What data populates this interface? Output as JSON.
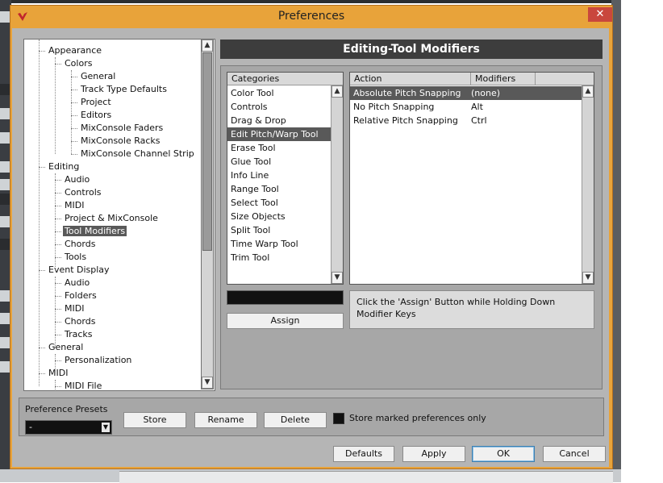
{
  "window": {
    "title": "Preferences",
    "close_glyph": "✕"
  },
  "tree": {
    "items": [
      {
        "label": "Appearance",
        "level": 1
      },
      {
        "label": "Colors",
        "level": 2
      },
      {
        "label": "General",
        "level": 3
      },
      {
        "label": "Track Type Defaults",
        "level": 3
      },
      {
        "label": "Project",
        "level": 3
      },
      {
        "label": "Editors",
        "level": 3
      },
      {
        "label": "MixConsole Faders",
        "level": 3
      },
      {
        "label": "MixConsole Racks",
        "level": 3
      },
      {
        "label": "MixConsole Channel Strip",
        "level": 3
      },
      {
        "label": "Editing",
        "level": 1
      },
      {
        "label": "Audio",
        "level": 2
      },
      {
        "label": "Controls",
        "level": 2
      },
      {
        "label": "MIDI",
        "level": 2
      },
      {
        "label": "Project & MixConsole",
        "level": 2
      },
      {
        "label": "Tool Modifiers",
        "level": 2,
        "selected": true
      },
      {
        "label": "Chords",
        "level": 2
      },
      {
        "label": "Tools",
        "level": 2
      },
      {
        "label": "Event Display",
        "level": 1
      },
      {
        "label": "Audio",
        "level": 2
      },
      {
        "label": "Folders",
        "level": 2
      },
      {
        "label": "MIDI",
        "level": 2
      },
      {
        "label": "Chords",
        "level": 2
      },
      {
        "label": "Tracks",
        "level": 2
      },
      {
        "label": "General",
        "level": 1
      },
      {
        "label": "Personalization",
        "level": 2
      },
      {
        "label": "MIDI",
        "level": 1
      },
      {
        "label": "MIDI File",
        "level": 2
      }
    ]
  },
  "panel": {
    "title": "Editing-Tool Modifiers",
    "categories": {
      "header": "Categories",
      "items": [
        "Color Tool",
        "Controls",
        "Drag & Drop",
        "Edit Pitch/Warp Tool",
        "Erase Tool",
        "Glue Tool",
        "Info Line",
        "Range Tool",
        "Select Tool",
        "Size Objects",
        "Split Tool",
        "Time Warp Tool",
        "Trim Tool"
      ],
      "selected_index": 3
    },
    "actions": {
      "headers": {
        "action": "Action",
        "modifiers": "Modifiers"
      },
      "rows": [
        {
          "action": "Absolute Pitch Snapping",
          "modifiers": "(none)"
        },
        {
          "action": "No Pitch Snapping",
          "modifiers": "Alt"
        },
        {
          "action": "Relative Pitch Snapping",
          "modifiers": "Ctrl"
        }
      ],
      "selected_index": 0
    },
    "modifier_field_value": "",
    "assign_label": "Assign",
    "hint": "Click the 'Assign' Button while Holding Down Modifier Keys"
  },
  "presets": {
    "label": "Preference Presets",
    "selected": "-",
    "store_label": "Store",
    "rename_label": "Rename",
    "delete_label": "Delete",
    "store_marked_label": "Store marked preferences only",
    "store_marked_checked": false
  },
  "footer": {
    "defaults_label": "Defaults",
    "apply_label": "Apply",
    "ok_label": "OK",
    "cancel_label": "Cancel"
  },
  "colors": {
    "window_frame": "#e8a33a",
    "selection": "#595959",
    "header_bg": "#3d3d3d",
    "close_button": "#c9473d"
  }
}
